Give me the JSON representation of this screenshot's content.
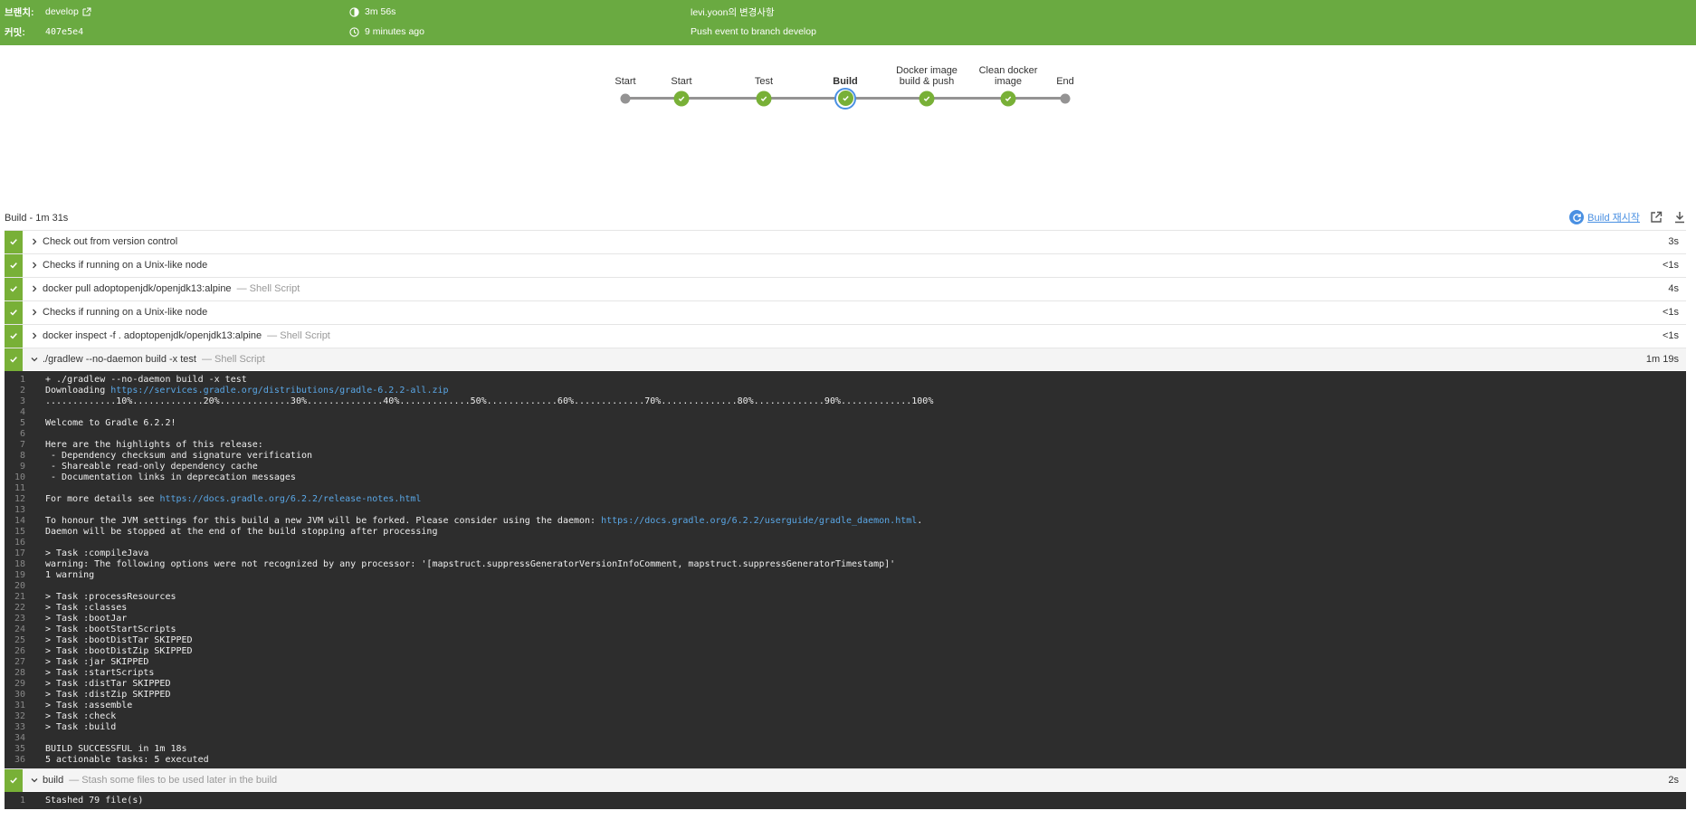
{
  "header": {
    "branch_label": "브랜치:",
    "branch_value": "develop",
    "commit_label": "커밋:",
    "commit_value": "407e5e4",
    "duration": "3m 56s",
    "time_ago": "9 minutes ago",
    "changes": "levi.yoon의 변경사항",
    "cause": "Push event to branch develop"
  },
  "pipeline": {
    "stages": [
      "Start",
      "Start",
      "Test",
      "Build",
      "Docker image build & push",
      "Clean docker image",
      "End"
    ],
    "stage_lines": [
      [
        "Start"
      ],
      [
        "Start"
      ],
      [
        "Test"
      ],
      [
        "Build"
      ],
      [
        "Docker image",
        "build & push"
      ],
      [
        "Clean docker",
        "image"
      ],
      [
        "End"
      ]
    ],
    "current_stage": "Build"
  },
  "build": {
    "title": "Build - 1m 31s",
    "rerun_label": "Build 재시작",
    "steps": [
      {
        "title": "Check out from version control",
        "sub": "",
        "duration": "3s",
        "expanded": false
      },
      {
        "title": "Checks if running on a Unix-like node",
        "sub": "",
        "duration": "<1s",
        "expanded": false
      },
      {
        "title": "docker pull adoptopenjdk/openjdk13:alpine",
        "sub": "— Shell Script",
        "duration": "4s",
        "expanded": false
      },
      {
        "title": "Checks if running on a Unix-like node",
        "sub": "",
        "duration": "<1s",
        "expanded": false
      },
      {
        "title": "docker inspect -f . adoptopenjdk/openjdk13:alpine",
        "sub": "— Shell Script",
        "duration": "<1s",
        "expanded": false
      },
      {
        "title": "./gradlew --no-daemon build -x test",
        "sub": "— Shell Script",
        "duration": "1m 19s",
        "expanded": true
      },
      {
        "title": "build",
        "sub": "— Stash some files to be used later in the build",
        "duration": "2s",
        "expanded": true
      }
    ],
    "gradle_log": [
      {
        "n": "1",
        "text": "+ ./gradlew --no-daemon build -x test"
      },
      {
        "n": "2",
        "text": "Downloading ",
        "link": "https://services.gradle.org/distributions/gradle-6.2.2-all.zip"
      },
      {
        "n": "3",
        "text": ".............10%.............20%.............30%..............40%.............50%.............60%.............70%..............80%.............90%.............100%"
      },
      {
        "n": "4",
        "text": ""
      },
      {
        "n": "5",
        "text": "Welcome to Gradle 6.2.2!"
      },
      {
        "n": "6",
        "text": ""
      },
      {
        "n": "7",
        "text": "Here are the highlights of this release:"
      },
      {
        "n": "8",
        "text": " - Dependency checksum and signature verification"
      },
      {
        "n": "9",
        "text": " - Shareable read-only dependency cache"
      },
      {
        "n": "10",
        "text": " - Documentation links in deprecation messages"
      },
      {
        "n": "11",
        "text": ""
      },
      {
        "n": "12",
        "text": "For more details see ",
        "link": "https://docs.gradle.org/6.2.2/release-notes.html"
      },
      {
        "n": "13",
        "text": ""
      },
      {
        "n": "14",
        "text": "To honour the JVM settings for this build a new JVM will be forked. Please consider using the daemon: ",
        "link": "https://docs.gradle.org/6.2.2/userguide/gradle_daemon.html",
        "after": "."
      },
      {
        "n": "15",
        "text": "Daemon will be stopped at the end of the build stopping after processing"
      },
      {
        "n": "16",
        "text": ""
      },
      {
        "n": "17",
        "text": "> Task :compileJava"
      },
      {
        "n": "18",
        "text": "warning: The following options were not recognized by any processor: '[mapstruct.suppressGeneratorVersionInfoComment, mapstruct.suppressGeneratorTimestamp]'"
      },
      {
        "n": "19",
        "text": "1 warning"
      },
      {
        "n": "20",
        "text": ""
      },
      {
        "n": "21",
        "text": "> Task :processResources"
      },
      {
        "n": "22",
        "text": "> Task :classes"
      },
      {
        "n": "23",
        "text": "> Task :bootJar"
      },
      {
        "n": "24",
        "text": "> Task :bootStartScripts"
      },
      {
        "n": "25",
        "text": "> Task :bootDistTar SKIPPED"
      },
      {
        "n": "26",
        "text": "> Task :bootDistZip SKIPPED"
      },
      {
        "n": "27",
        "text": "> Task :jar SKIPPED"
      },
      {
        "n": "28",
        "text": "> Task :startScripts"
      },
      {
        "n": "29",
        "text": "> Task :distTar SKIPPED"
      },
      {
        "n": "30",
        "text": "> Task :distZip SKIPPED"
      },
      {
        "n": "31",
        "text": "> Task :assemble"
      },
      {
        "n": "32",
        "text": "> Task :check"
      },
      {
        "n": "33",
        "text": "> Task :build"
      },
      {
        "n": "34",
        "text": ""
      },
      {
        "n": "35",
        "text": "BUILD SUCCESSFUL in 1m 18s"
      },
      {
        "n": "36",
        "text": "5 actionable tasks: 5 executed"
      }
    ],
    "stash_log": [
      {
        "n": "1",
        "text": "Stashed 79 file(s)"
      }
    ]
  },
  "colors": {
    "header_bg": "#6aaa41",
    "success": "#78b037",
    "link": "#4a90e2",
    "log_bg": "#2d2d2d"
  },
  "icons": {
    "duration": "clock-half-icon",
    "time": "clock-icon",
    "external": "external-link-icon",
    "rerun": "rerun-icon",
    "open": "open-in-new-icon",
    "download": "download-icon",
    "check": "check-icon",
    "chevron_right": "chevron-right-icon",
    "chevron_down": "chevron-down-icon"
  }
}
